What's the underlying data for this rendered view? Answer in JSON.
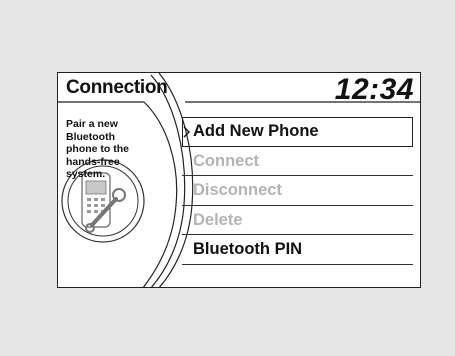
{
  "screen": {
    "title": "Connection",
    "clock": "12:34",
    "hint": "Pair a new Bluetooth phone to the hands-free system."
  },
  "menu": {
    "items": [
      {
        "label": "Add New Phone",
        "state": "selected"
      },
      {
        "label": "Connect",
        "state": "disabled"
      },
      {
        "label": "Disconnect",
        "state": "disabled"
      },
      {
        "label": "Delete",
        "state": "disabled"
      },
      {
        "label": "Bluetooth PIN",
        "state": "enabled"
      }
    ]
  },
  "colors": {
    "background": "#e6e6e6",
    "screen": "#ffffff",
    "text": "#111111",
    "disabled_text": "#b4b4b4"
  },
  "icons": [
    "phone-wrench-icon",
    "selection-cursor-icon"
  ]
}
